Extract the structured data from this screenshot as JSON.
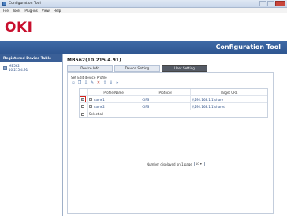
{
  "window": {
    "title": "Configuration Tool"
  },
  "menu": [
    "File",
    "Tools",
    "Plug-ins",
    "View",
    "Help"
  ],
  "header": {
    "logo": "OKI",
    "app_title": "Configuration Tool"
  },
  "sidebar": {
    "title": "Registered Device Table",
    "device": {
      "line1": "MB562",
      "line2": "10.215.4.91"
    }
  },
  "main": {
    "device_title": "MB562(10.215.4.91)",
    "tabs": [
      {
        "label": "Device Info",
        "active": false
      },
      {
        "label": "Device Setting",
        "active": false
      },
      {
        "label": "User Setting",
        "active": true
      }
    ],
    "panel_title": "Set Edit device Profile",
    "toolbar_icons": [
      "add-icon",
      "copy-icon",
      "import-icon",
      "edit-icon",
      "delete-icon",
      "upload-icon",
      "download-icon",
      "play-icon"
    ],
    "table": {
      "headers": [
        "Profile Name",
        "Protocol",
        "Target URL"
      ],
      "rows": [
        {
          "checked": true,
          "name": "name1",
          "protocol": "CIFS",
          "url": "\\\\192.168.1.1\\share"
        },
        {
          "checked": false,
          "name": "name2",
          "protocol": "CIFS",
          "url": "\\\\192.168.1.1\\shared"
        }
      ],
      "select_all": "Select all"
    },
    "pager": {
      "label": "Number displayed on 1 page",
      "value": "10"
    },
    "bottom_icons": [
      "upload-icon",
      "import-icon",
      "edit-icon",
      "delete-icon"
    ]
  },
  "colors": {
    "brand_red": "#c8102e",
    "band_blue": "#2e5590",
    "highlight_red": "#d2231c"
  }
}
